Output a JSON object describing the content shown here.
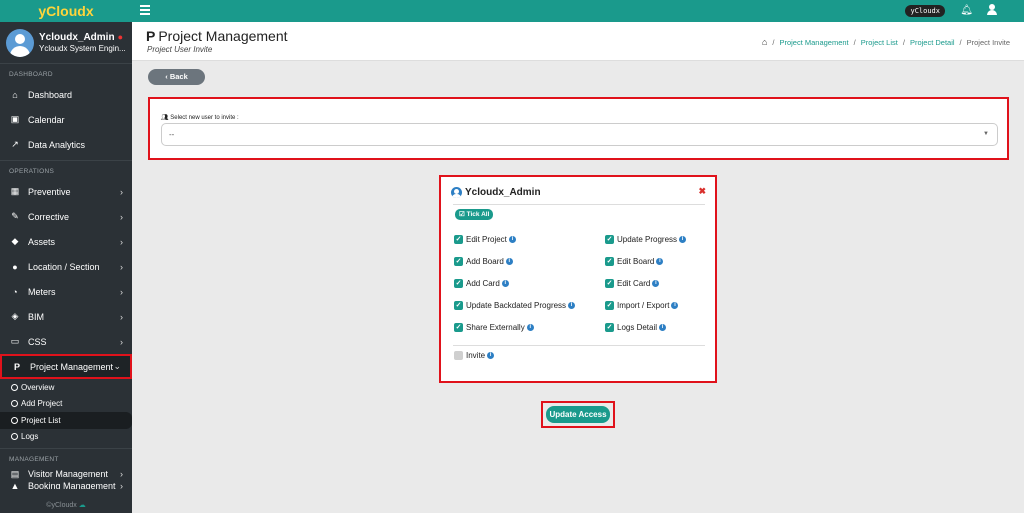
{
  "brand": "yCloudx",
  "user": {
    "name": "Ycloudx_Admin",
    "role": "Ycloudx System Engin..."
  },
  "sidebar": {
    "dashboard_label": "DASHBOARD",
    "dashboard_items": [
      {
        "label": "Dashboard",
        "icon": "home-icon"
      },
      {
        "label": "Calendar",
        "icon": "calendar-icon"
      },
      {
        "label": "Data Analytics",
        "icon": "chart-icon"
      }
    ],
    "operations_label": "OPERATIONS",
    "operations_items": [
      {
        "label": "Preventive",
        "icon": "calendar-check-icon"
      },
      {
        "label": "Corrective",
        "icon": "wrench-icon"
      },
      {
        "label": "Assets",
        "icon": "tag-icon"
      },
      {
        "label": "Location / Section",
        "icon": "globe-icon"
      },
      {
        "label": "Meters",
        "icon": "gauge-icon"
      },
      {
        "label": "BIM",
        "icon": "cube-icon"
      },
      {
        "label": "CSS",
        "icon": "monitor-icon"
      },
      {
        "label": "Project Management",
        "icon": "project-icon"
      }
    ],
    "sub_items": [
      "Overview",
      "Add Project",
      "Project List",
      "Logs"
    ],
    "management_label": "MANAGEMENT",
    "management_items": [
      {
        "label": "Visitor Management",
        "icon": "visitor-icon"
      },
      {
        "label": "Booking Management",
        "icon": "booking-icon"
      }
    ],
    "footer": "©yCloudx"
  },
  "topbar": {
    "user_badge": "yCloudx"
  },
  "header": {
    "title": "Project Management",
    "subtitle": "Project User Invite",
    "breadcrumb": [
      "Project Management",
      "Project List",
      "Project Detail",
      "Project Invite"
    ]
  },
  "back_label": "Back",
  "invite": {
    "label": "Select new user to invite :",
    "value": "--"
  },
  "card": {
    "user": "Ycloudx_Admin",
    "tick_all": "Tick All",
    "left_perms": [
      "Edit Project",
      "Add Board",
      "Add Card",
      "Update Backdated Progress",
      "Share Externally"
    ],
    "right_perms": [
      "Update Progress",
      "Edit Board",
      "Edit Card",
      "Import / Export",
      "Logs Detail"
    ],
    "invite_perm": "Invite"
  },
  "update_label": "Update Access",
  "colors": {
    "accent": "#1a9a8c",
    "highlight": "#e0121b",
    "brand_text": "#ffd43b",
    "sidebar": "#2b3136"
  }
}
